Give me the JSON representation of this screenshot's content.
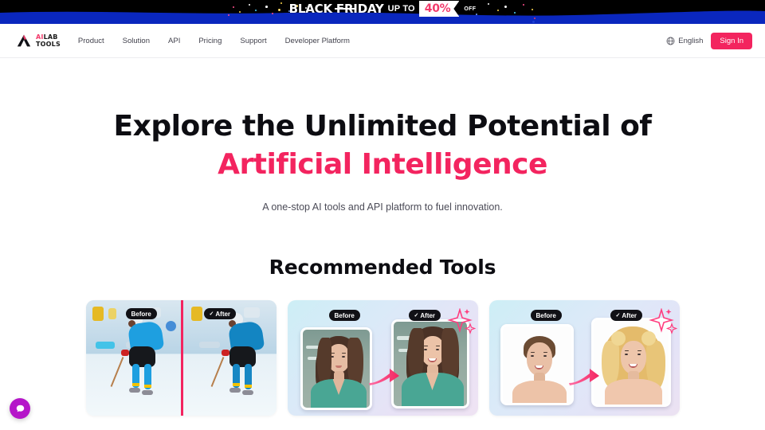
{
  "promo": {
    "title": "BLACK FRIDAY",
    "up_to": "UP TO",
    "discount": "40%",
    "off": "OFF",
    "bg_color": "#000000",
    "wave_color": "#0a27be",
    "accent_color": "#f23b6c"
  },
  "header": {
    "logo": {
      "icon": "mountain-logo-icon",
      "text_ai": "AI",
      "text_lab": "LAB",
      "text_tools": "TOOLS"
    },
    "nav": [
      {
        "label": "Product"
      },
      {
        "label": "Solution"
      },
      {
        "label": "API"
      },
      {
        "label": "Pricing"
      },
      {
        "label": "Support"
      },
      {
        "label": "Developer Platform"
      }
    ],
    "language": {
      "icon": "globe-icon",
      "label": "English"
    },
    "signin": {
      "label": "Sign In",
      "color": "#f3245f"
    }
  },
  "hero": {
    "line1": "Explore the Unlimited Potential of",
    "line2": "Artificial Intelligence",
    "accent_color": "#f3245f",
    "subtitle": "A one-stop AI tools and API platform to fuel innovation."
  },
  "recommended": {
    "title": "Recommended Tools",
    "labels": {
      "before": "Before",
      "after": "After",
      "check": "✓"
    },
    "cards": [
      {
        "name": "image-enhancer-hockey",
        "before": "Before",
        "after": "After"
      },
      {
        "name": "portrait-retouch-smile",
        "before": "Before",
        "after": "After"
      },
      {
        "name": "hairstyle-changer-blonde",
        "before": "Before",
        "after": "After"
      }
    ]
  },
  "chat_widget": {
    "icon": "chat-bubble-icon",
    "color": "#b516c9"
  }
}
